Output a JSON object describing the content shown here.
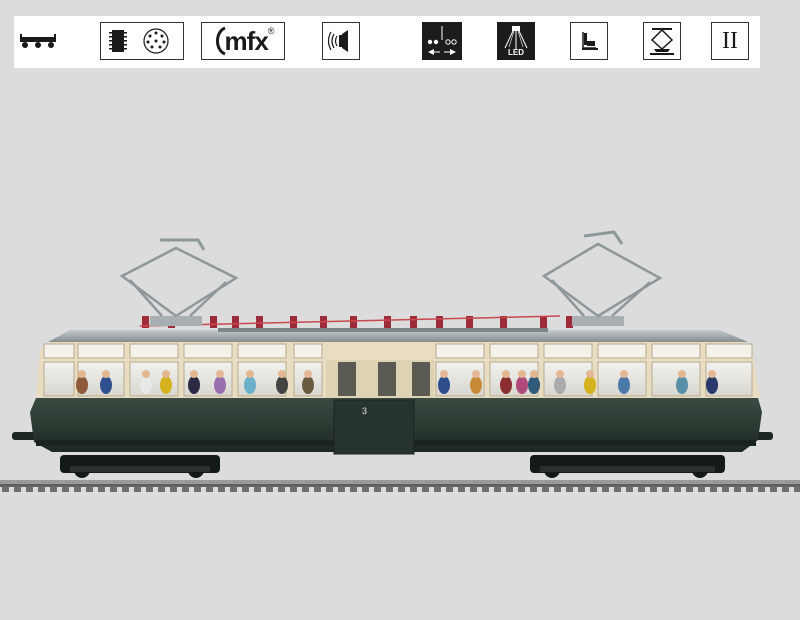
{
  "icon_bar": {
    "icons": [
      {
        "name": "wheel-arrangement-icon"
      },
      {
        "name": "decoder-socket-icon"
      },
      {
        "name": "mfx-logo-icon",
        "text": "mfx"
      },
      {
        "name": "sound-icon"
      },
      {
        "name": "lighting-direction-icon"
      },
      {
        "name": "led-lighting-icon",
        "text": "LED"
      },
      {
        "name": "interior-lighting-icon"
      },
      {
        "name": "pantograph-icon"
      },
      {
        "name": "epoch-icon",
        "text": "II"
      }
    ]
  },
  "product_image": {
    "name": "glass-railcar-model",
    "car_number": "3",
    "colors": {
      "lower_body": "#2c3a32",
      "upper_body": "#e8ddc2",
      "roof": "#9aa3a6",
      "roof_insulators": "#9e2b3a",
      "rail": "#8a8a8a",
      "background": "#dcdcdc"
    }
  }
}
